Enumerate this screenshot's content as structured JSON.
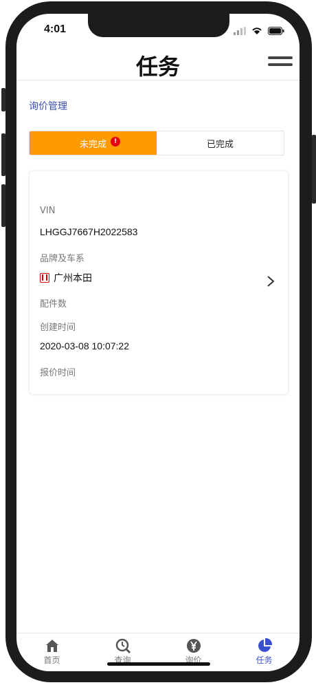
{
  "status_bar": {
    "time": "4:01"
  },
  "header": {
    "title": "任务"
  },
  "breadcrumb": "询价管理",
  "segments": [
    {
      "label": "未完成",
      "active": true,
      "badge": "!"
    },
    {
      "label": "已完成",
      "active": false
    }
  ],
  "card": {
    "vin_label": "VIN",
    "vin_value": "LHGGJ7667H2022583",
    "brand_label": "品牌及车系",
    "brand_value": "广州本田",
    "parts_label": "配件数",
    "parts_value": "",
    "created_label": "创建时间",
    "created_value": "2020-03-08 10:07:22",
    "quote_label": "报价时间",
    "quote_value": ""
  },
  "tabbar": {
    "items": [
      {
        "label": "首页",
        "icon": "home-icon"
      },
      {
        "label": "查询",
        "icon": "search-icon"
      },
      {
        "label": "询价",
        "icon": "yen-icon"
      },
      {
        "label": "任务",
        "icon": "pie-chart-icon",
        "active": true
      }
    ],
    "accent": "#3a4fd0"
  },
  "colors": {
    "segment_active": "#ff9a00",
    "badge": "#e60012",
    "breadcrumb": "#3a4fa8"
  }
}
